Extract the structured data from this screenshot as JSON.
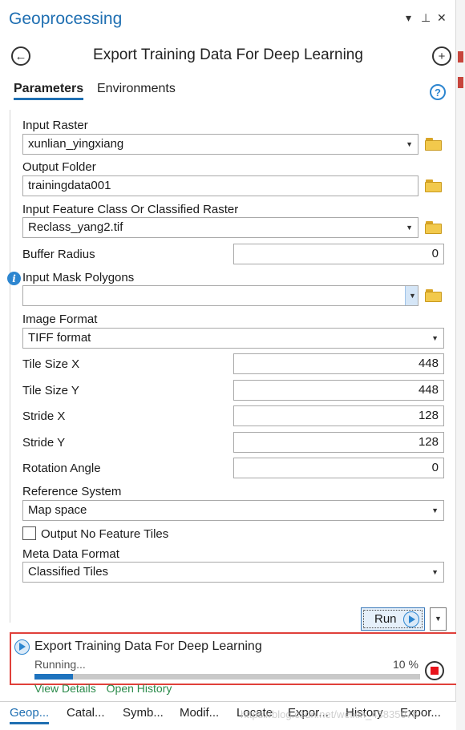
{
  "header": {
    "title": "Geoprocessing",
    "menu_icon": "▾",
    "pin_icon": "⊥",
    "close_icon": "✕"
  },
  "tool": {
    "title": "Export Training Data For Deep Learning",
    "back_icon": "←",
    "add_icon": "+"
  },
  "tabs": {
    "parameters": "Parameters",
    "environments": "Environments",
    "help_icon": "?"
  },
  "params": {
    "input_raster": {
      "label": "Input Raster",
      "value": "xunlian_yingxiang"
    },
    "output_folder": {
      "label": "Output Folder",
      "value": "trainingdata001"
    },
    "input_feature": {
      "label": "Input Feature Class Or Classified Raster",
      "value": "Reclass_yang2.tif"
    },
    "buffer_radius": {
      "label": "Buffer Radius",
      "value": "0"
    },
    "input_mask": {
      "label": "Input Mask Polygons",
      "value": ""
    },
    "image_format": {
      "label": "Image Format",
      "value": "TIFF format"
    },
    "tile_size_x": {
      "label": "Tile Size X",
      "value": "448"
    },
    "tile_size_y": {
      "label": "Tile Size Y",
      "value": "448"
    },
    "stride_x": {
      "label": "Stride X",
      "value": "128"
    },
    "stride_y": {
      "label": "Stride Y",
      "value": "128"
    },
    "rotation_angle": {
      "label": "Rotation Angle",
      "value": "0"
    },
    "reference_system": {
      "label": "Reference System",
      "value": "Map space"
    },
    "output_no_feature": {
      "label": "Output No Feature Tiles",
      "checked": false
    },
    "meta_data_format": {
      "label": "Meta Data Format",
      "value": "Classified Tiles"
    }
  },
  "run": {
    "label": "Run"
  },
  "progress": {
    "title": "Export Training Data For Deep Learning",
    "status": "Running...",
    "percent_text": "10 %",
    "percent": 10,
    "view_details": "View Details",
    "open_history": "Open History"
  },
  "bottom_tabs": [
    "Geop...",
    "Catal...",
    "Symb...",
    "Modif...",
    "Locate",
    "Expor...",
    "History",
    "Expor..."
  ],
  "watermark": "https://blog.csdn.net/weixin_43835078",
  "colors": {
    "accent": "#1f6fb2",
    "highlight_border": "#e0403a",
    "progress_fill": "#1e73be",
    "stop_red": "#e8141c"
  }
}
